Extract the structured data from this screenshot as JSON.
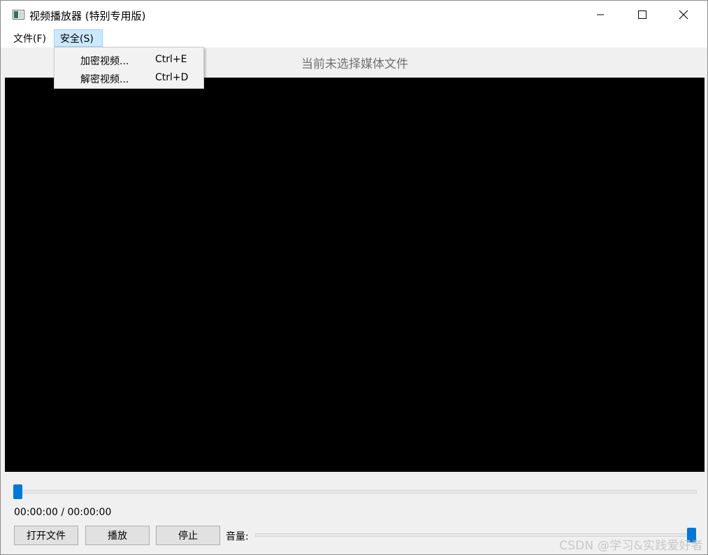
{
  "window": {
    "title": "视频播放器 (特别专用版)",
    "app_icon": "video-player-icon",
    "controls": {
      "minimize": "minimize-icon",
      "maximize": "maximize-icon",
      "close": "close-icon"
    }
  },
  "menubar": {
    "items": [
      {
        "label": "文件(F)",
        "active": false
      },
      {
        "label": "安全(S)",
        "active": true
      }
    ]
  },
  "dropdown": {
    "items": [
      {
        "label": "加密视频...",
        "shortcut": "Ctrl+E"
      },
      {
        "label": "解密视频...",
        "shortcut": "Ctrl+D"
      }
    ]
  },
  "media": {
    "status": "当前未选择媒体文件"
  },
  "playback": {
    "time": "00:00:00 / 00:00:00",
    "progress_fraction": 0.0
  },
  "controls": {
    "open": "打开文件",
    "play": "播放",
    "stop": "停止",
    "volume_label": "音量:",
    "volume_fraction": 1.0
  },
  "colors": {
    "accent": "#0078d7",
    "menu_highlight": "#cce8ff",
    "video_bg": "#000000"
  },
  "watermark": "CSDN @学习&实践爱好者"
}
